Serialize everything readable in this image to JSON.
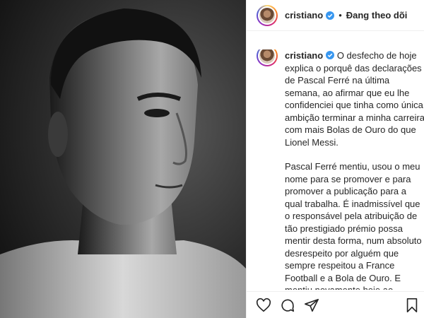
{
  "post": {
    "photo_alt": "",
    "header": {
      "username": "cristiano",
      "separator": "•",
      "follow_status": "Đang theo dõi"
    },
    "caption": {
      "username": "cristiano",
      "paragraph_1": "O desfecho de hoje explica o porquê das declarações de Pascal Ferré na última semana, ao afirmar que eu lhe confidenciei que tinha como única ambição terminar a minha carreira com mais Bolas de Ouro do que Lionel Messi.",
      "paragraph_2": "Pascal Ferré mentiu, usou o meu nome para se promover e para promover a publicação para a qual trabalha. É inadmissível que o responsável pela atribuição de tão prestigiado prémio possa mentir desta forma, num absoluto desrespeito por alguém que sempre respeitou a France Football e a Bola de Ouro. E mentiu novamente hoje ao justificar a minha ausência da Gala com uma alegada quarentena que não"
    },
    "actions": {
      "icons": [
        "heart-icon",
        "comment-icon",
        "share-icon",
        "bookmark-icon"
      ]
    },
    "colors": {
      "verified_blue": "#3897f0",
      "text": "#262626",
      "border": "#efefef"
    }
  }
}
